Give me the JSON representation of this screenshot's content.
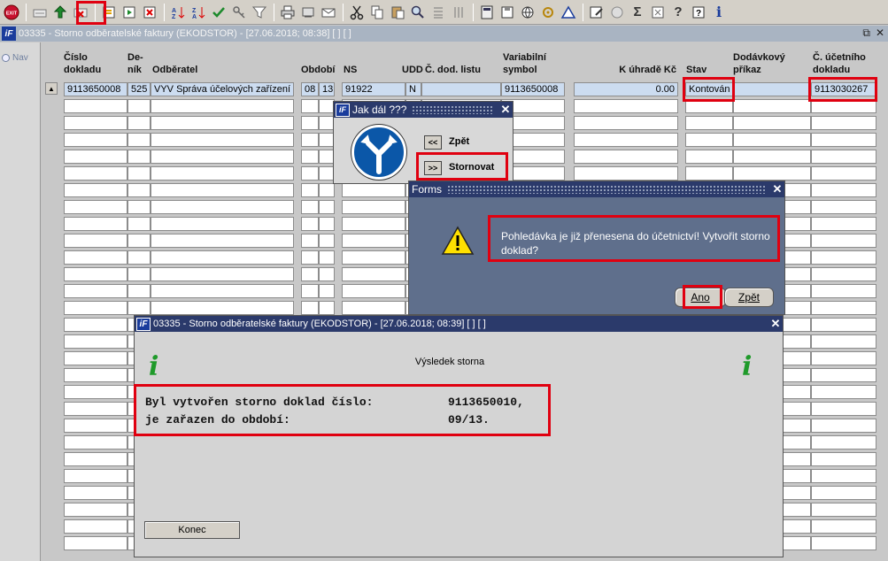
{
  "toolbar": {
    "icons": [
      "exit-icon",
      "insert-record-icon",
      "save-icon",
      "delete-record-icon",
      "query-icon",
      "execute-query-icon",
      "cancel-query-icon",
      "sort-asc-icon",
      "sort-desc-icon",
      "check-icon",
      "key-icon",
      "filter-icon",
      "print-icon",
      "print-preview-icon",
      "mail-icon",
      "scissors-icon",
      "copy-icon",
      "paste-icon",
      "zoom-icon",
      "list-icon",
      "columns-icon",
      "calculator-icon",
      "floppy-icon",
      "globe-icon",
      "settings-icon",
      "chart-icon",
      "edit-icon",
      "clock-icon",
      "sum-icon",
      "excel-icon",
      "help-icon",
      "context-help-icon",
      "info-icon"
    ],
    "exit_label": "EXIT",
    "sum_label": "Σ",
    "help_label": "?",
    "info_label": "i"
  },
  "main_window": {
    "title": "03335 - Storno odběratelské faktury (EKODSTOR) - [27.06.2018; 08:38]  [ ]  [ ]"
  },
  "nav": {
    "label": "Nav"
  },
  "table": {
    "headers": {
      "cislo_dokladu": "Číslo dokladu",
      "denik": "De-ník",
      "odberatel": "Odběratel",
      "obdobi": "Období",
      "ns": "NS",
      "udd": "UDD",
      "c_dod_listu": "Č. dod. listu",
      "variabilni_symbol": "Variabilní symbol",
      "k_uhrade": "K úhradě Kč",
      "stav": "Stav",
      "dodavkovy_prikaz": "Dodávkový příkaz",
      "c_ucetniho_dokladu": "Č. účetního dokladu"
    },
    "row": {
      "cislo_dokladu": "9113650008",
      "denik": "525",
      "odberatel": "VYV Správa účelových zařízení",
      "obdobi_m": "08",
      "obdobi_r": "13",
      "ns": "91922",
      "udd": "N",
      "c_dod_listu": "",
      "variabilni_symbol": "9113650008",
      "k_uhrade": "0.00",
      "stav": "Kontován",
      "dodavkovy_prikaz": "",
      "c_ucetniho_dokladu": "9113030267"
    }
  },
  "jak_dal": {
    "title": "Jak dál ???",
    "back_btn": "<<",
    "back_label": "Zpět",
    "storno_btn": ">>",
    "storno_label": "Stornovat"
  },
  "forms": {
    "title": "Forms",
    "message": "Pohledávka je již přenesena do účetnictví! Vytvořit storno doklad?",
    "yes_label": "Ano",
    "back_label": "Zpět"
  },
  "result": {
    "title": "03335 - Storno odběratelské faktury (EKODSTOR) - [27.06.2018; 08:39]  [ ]  [ ]",
    "heading": "Výsledek storna",
    "line1_label": "Byl vytvořen storno doklad číslo:",
    "line1_value": "9113650010,",
    "line2_label": "je zařazen do období:",
    "line2_value": "09/13.",
    "konec_label": "Konec"
  }
}
